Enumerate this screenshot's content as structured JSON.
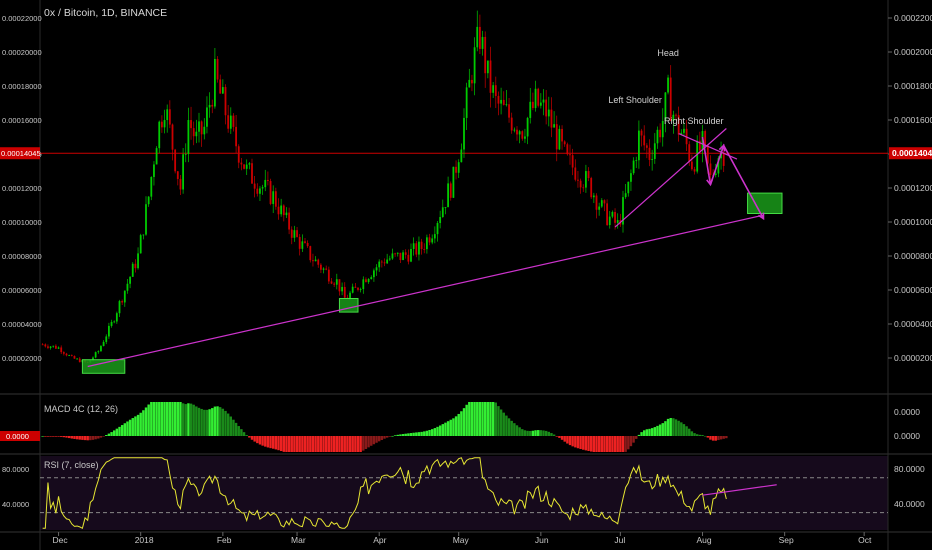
{
  "header": {
    "symbol_title": "0x / Bitcoin, 1D, BINANCE"
  },
  "price_pane": {
    "y_ticks": [
      "0.00022000",
      "0.00020000",
      "0.00018000",
      "0.00016000",
      "0.00014000",
      "0.00012000",
      "0.00010000",
      "0.00008000",
      "0.00006000",
      "0.00004000",
      "0.00002000"
    ],
    "current_price_label": "0.00014045",
    "colors": {
      "up": "#00cc00",
      "down": "#cc0000",
      "trendline": "#cc33cc",
      "price_line": "#cc0000",
      "zone": "#22aa22"
    }
  },
  "annotations": {
    "head": "Head",
    "left_shoulder": "Left Shoulder",
    "right_shoulder": "Right Shoulder"
  },
  "macd_pane": {
    "title": "MACD 4C (12, 26)",
    "y_ticks": [
      "0.0000",
      "0.0000"
    ]
  },
  "rsi_pane": {
    "title": "RSI (7, close)",
    "y_ticks": [
      "80.0000",
      "40.0000"
    ]
  },
  "x_axis": {
    "ticks": [
      "Dec",
      "2018",
      "Feb",
      "Mar",
      "Apr",
      "May",
      "Jun",
      "Jul",
      "Aug",
      "Sep",
      "Oct"
    ]
  },
  "chart_data": {
    "type": "candlestick",
    "x_range": [
      "2017-11-24",
      "2018-10-10"
    ],
    "ylim": [
      0,
      0.00022
    ],
    "current_price": 0.00014045,
    "close_series": [
      [
        "2017-11-25",
        2.8e-05
      ],
      [
        "2017-12-01",
        2.6e-05
      ],
      [
        "2017-12-06",
        2e-05
      ],
      [
        "2017-12-12",
        1.7e-05
      ],
      [
        "2017-12-16",
        2.4e-05
      ],
      [
        "2017-12-21",
        4e-05
      ],
      [
        "2017-12-26",
        6e-05
      ],
      [
        "2017-12-31",
        8e-05
      ],
      [
        "2018-01-04",
        0.000115
      ],
      [
        "2018-01-07",
        0.00015
      ],
      [
        "2018-01-10",
        0.00017
      ],
      [
        "2018-01-13",
        0.000145
      ],
      [
        "2018-01-16",
        0.00012
      ],
      [
        "2018-01-19",
        0.00016
      ],
      [
        "2018-01-22",
        0.000148
      ],
      [
        "2018-01-25",
        0.000155
      ],
      [
        "2018-01-29",
        0.000185
      ],
      [
        "2018-02-01",
        0.00017
      ],
      [
        "2018-02-05",
        0.00015
      ],
      [
        "2018-02-10",
        0.00013
      ],
      [
        "2018-02-15",
        0.000122
      ],
      [
        "2018-02-20",
        0.000115
      ],
      [
        "2018-02-25",
        0.0001
      ],
      [
        "2018-03-01",
        9e-05
      ],
      [
        "2018-03-06",
        8e-05
      ],
      [
        "2018-03-11",
        7.2e-05
      ],
      [
        "2018-03-16",
        6.5e-05
      ],
      [
        "2018-03-19",
        5.5e-05
      ],
      [
        "2018-03-23",
        6e-05
      ],
      [
        "2018-03-27",
        6.8e-05
      ],
      [
        "2018-04-03",
        7.8e-05
      ],
      [
        "2018-04-10",
        8e-05
      ],
      [
        "2018-04-17",
        8.5e-05
      ],
      [
        "2018-04-21",
        9.5e-05
      ],
      [
        "2018-04-25",
        0.00011
      ],
      [
        "2018-04-29",
        0.000125
      ],
      [
        "2018-05-02",
        0.00015
      ],
      [
        "2018-05-06",
        0.00019
      ],
      [
        "2018-05-09",
        0.00021
      ],
      [
        "2018-05-12",
        0.000185
      ],
      [
        "2018-05-15",
        0.00017
      ],
      [
        "2018-05-20",
        0.000162
      ],
      [
        "2018-05-25",
        0.000155
      ],
      [
        "2018-05-30",
        0.00017
      ],
      [
        "2018-06-03",
        0.000165
      ],
      [
        "2018-06-07",
        0.00015
      ],
      [
        "2018-06-11",
        0.000135
      ],
      [
        "2018-06-15",
        0.00013
      ],
      [
        "2018-06-20",
        0.00012
      ],
      [
        "2018-06-25",
        0.000105
      ],
      [
        "2018-06-30",
        9.8e-05
      ],
      [
        "2018-07-04",
        0.00012
      ],
      [
        "2018-07-08",
        0.00015
      ],
      [
        "2018-07-12",
        0.00014
      ],
      [
        "2018-07-17",
        0.00016
      ],
      [
        "2018-07-19",
        0.000175
      ],
      [
        "2018-07-22",
        0.000158
      ],
      [
        "2018-07-25",
        0.00015
      ],
      [
        "2018-07-28",
        0.000135
      ],
      [
        "2018-08-01",
        0.000145
      ],
      [
        "2018-08-04",
        0.000125
      ],
      [
        "2018-08-07",
        0.00014
      ],
      [
        "2018-08-10",
        0.000142
      ]
    ],
    "trendlines": [
      {
        "from": [
          "2017-12-12",
          1.5e-05
        ],
        "to": [
          "2018-08-24",
          0.000104
        ]
      },
      {
        "from": [
          "2018-06-29",
          9.7e-05
        ],
        "to": [
          "2018-08-10",
          0.000155
        ]
      },
      {
        "from": [
          "2018-07-23",
          0.000152
        ],
        "to": [
          "2018-08-14",
          0.000137
        ]
      }
    ],
    "projection_arrows": [
      {
        "points": [
          [
            "2018-08-01",
            0.00015
          ],
          [
            "2018-08-04",
            0.000122
          ],
          [
            "2018-08-09",
            0.000145
          ],
          [
            "2018-08-24",
            0.000102
          ]
        ]
      }
    ],
    "zones": [
      {
        "from": [
          "2017-12-10",
          1.9e-05
        ],
        "to": [
          "2017-12-26",
          1.1e-05
        ]
      },
      {
        "from": [
          "2018-03-17",
          5.5e-05
        ],
        "to": [
          "2018-03-24",
          4.7e-05
        ]
      },
      {
        "from": [
          "2018-08-18",
          0.000117
        ],
        "to": [
          "2018-08-31",
          0.000105
        ]
      }
    ],
    "rsi": {
      "overbought": 70,
      "oversold": 30,
      "ylim": [
        10,
        95
      ]
    }
  }
}
